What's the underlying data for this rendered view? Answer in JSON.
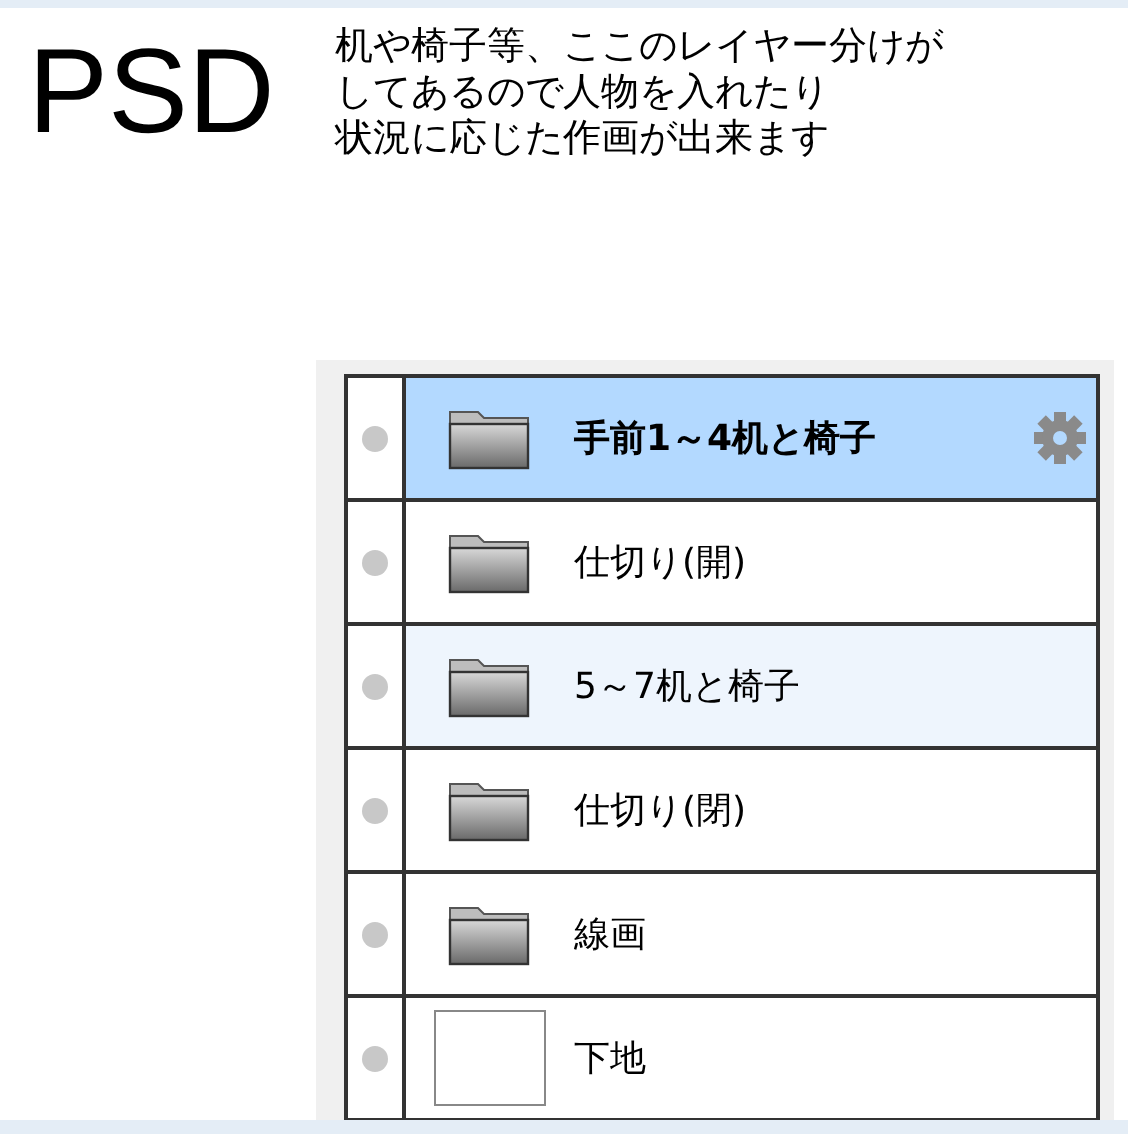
{
  "heading": "PSD",
  "description": [
    "机や椅子等、ここのレイヤー分けが",
    "してあるので人物を入れたり",
    "状況に応じた作画が出来ます"
  ],
  "layers": [
    {
      "kind": "folder",
      "name": "手前1～4机と椅子",
      "selected": true,
      "highlighted": false
    },
    {
      "kind": "folder",
      "name": "仕切り(開)",
      "selected": false,
      "highlighted": false
    },
    {
      "kind": "folder",
      "name": "5～7机と椅子",
      "selected": false,
      "highlighted": true
    },
    {
      "kind": "folder",
      "name": "仕切り(閉)",
      "selected": false,
      "highlighted": false
    },
    {
      "kind": "folder",
      "name": "線画",
      "selected": false,
      "highlighted": false
    },
    {
      "kind": "layer",
      "name": "下地",
      "selected": false,
      "highlighted": false
    }
  ]
}
